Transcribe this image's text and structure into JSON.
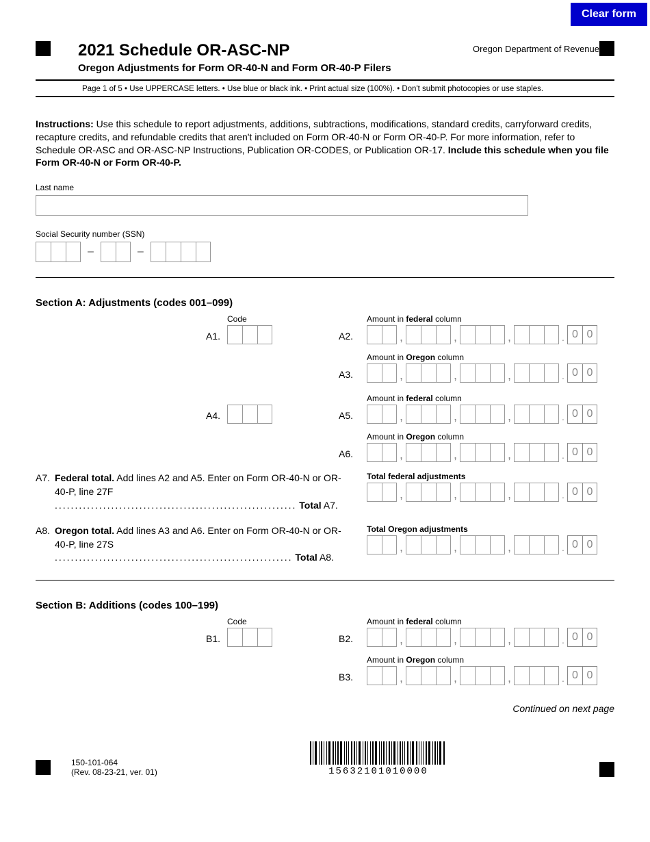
{
  "clear_button": "Clear form",
  "header": {
    "title": "2021 Schedule OR-ASC-NP",
    "subtitle": "Oregon Adjustments for Form OR-40-N and Form OR-40-P Filers",
    "dept": "Oregon Department of Revenue"
  },
  "meta": "Page 1 of 5     • Use UPPERCASE letters.  • Use blue or black ink.  • Print actual size (100%).  • Don't submit photocopies or use staples.",
  "instructions": {
    "lead": "Instructions:",
    "body1": " Use this schedule to report adjustments, additions, subtractions, modifications, standard credits, carryforward credits, recapture credits, and refundable credits that aren't included on Form OR-40-N or Form OR-40-P. For more information, refer to Schedule OR-ASC and OR-ASC-NP Instructions, Publication OR-CODES, or Publication OR-17. ",
    "bold_tail": "Include this schedule when you file Form OR-40-N or Form OR-40-P."
  },
  "labels": {
    "last_name": "Last name",
    "ssn": "Social Security number (SSN)",
    "code": "Code",
    "fed": "Amount in ",
    "fed_b": "federal",
    "fed_tail": " column",
    "ore": "Amount in ",
    "ore_b": "Oregon",
    "ore_tail": " column",
    "tot_fed": "Total federal adjustments",
    "tot_ore": "Total Oregon adjustments",
    "continued": "Continued on next page"
  },
  "sectionA": {
    "title": "Section A: Adjustments (codes 001–099)",
    "a1": "A1.",
    "a2": "A2.",
    "a3": "A3.",
    "a4": "A4.",
    "a5": "A5.",
    "a6": "A6.",
    "a7_num": "A7.",
    "a7_lead": "Federal total.",
    "a7_body": " Add lines A2 and A5. Enter on Form OR-40-N or OR-40-P, line 27F",
    "a7_dots": "............................................................",
    "a7_tail": "Total",
    "a7_tail2": " A7.",
    "a8_num": "A8.",
    "a8_lead": "Oregon total.",
    "a8_body": " Add lines A3 and A6. Enter on Form OR-40-N or OR-40-P, line 27S ",
    "a8_dots": "...........................................................",
    "a8_tail": "Total",
    "a8_tail2": " A8."
  },
  "sectionB": {
    "title": "Section B: Additions (codes 100–199)",
    "b1": "B1.",
    "b2": "B2.",
    "b3": "B3."
  },
  "footer": {
    "form_id": "150-101-064",
    "rev": "(Rev. 08-23-21, ver. 01)",
    "barcode_num": "15632101010000"
  },
  "cents": "0"
}
